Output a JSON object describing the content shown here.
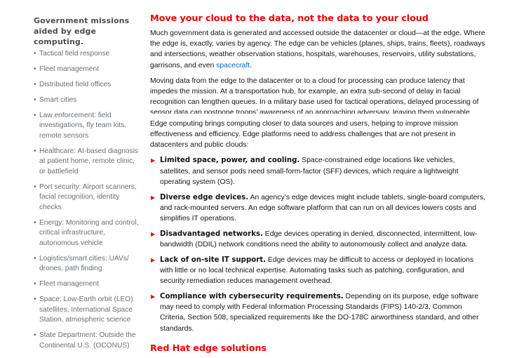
{
  "sidebar": {
    "title": "Government missions aided by edge computing.",
    "bullet": "•",
    "items": [
      {
        "label": "Tactical field response"
      },
      {
        "label": "Fleet management"
      },
      {
        "label": "Distributed field offices"
      },
      {
        "label": "Smart cities"
      },
      {
        "label": "Law enforcement: field investigations, fly team kits, remote sensors"
      },
      {
        "label": "Healthcare: AI-based diagnosis at patient home, remote clinic, or battlefield"
      },
      {
        "label": "Port security: Airport scanners, facial recognition, identity checks"
      },
      {
        "label": "Energy: Monitoring and control, critical infrastructure, autonomous vehicle"
      },
      {
        "label": "Logistics/smart cities: UAVs/ drones, path finding"
      },
      {
        "label": "Fleet management"
      },
      {
        "label": "Space: Low-Earth orbit (LEO) satellites, International Space Station, atmospheric science"
      },
      {
        "label": "State Department: Outside the Continental U.S. (OCONUS)"
      }
    ]
  },
  "main": {
    "heading": "Move your cloud to the data, not the data to your cloud",
    "paragraph1_text": "Much government data is generated and accessed outside the datacenter or cloud—at the edge. Where the edge is, exactly, varies by agency. The edge can be vehicles (planes, ships, trains, fleets), roadways and intersections, weather observation stations, hospitals, warehouses, reservoirs, utility substations, garrisons, and even ",
    "paragraph1_link": "spacecraft",
    "paragraph1_end": ".",
    "paragraph2": "Moving data from the edge to the datacenter or to a cloud for processing can produce latency that impedes the mission. At a transportation hub, for example, an extra sub-second of delay in facial recognition can lengthen queues. In a military base used for tactical operations, delayed processing of sensor data can postpone troops’ awareness of an approaching adversary, leaving them vulnerable.",
    "paragraph3": "Edge computing brings computing closer to data sources and users, helping to improve mission effectiveness and efficiency. Edge platforms need to address challenges that are not present in datacenters and public clouds:",
    "arrow": "▶",
    "challenges": [
      {
        "title": "Limited space, power, and cooling.",
        "text": " Space-constrained edge locations like vehicles, satellites, and sensor pods need small-form-factor (SFF) devices, which require a lightweight operating system (OS)."
      },
      {
        "title": "Diverse edge devices.",
        "text": " An agency’s edge devices might include tablets, single-board computers, and rack-mounted servers. An edge software platform that can run on all devices lowers costs and simplifies IT operations."
      },
      {
        "title": "Disadvantaged networks.",
        "text": " Edge devices operating in denied, disconnected, intermittent, low-bandwidth (DDIL) network conditions need the ability to autonomously collect and analyze data."
      },
      {
        "title": "Lack of on-site IT support.",
        "text": " Edge devices may be difficult to access or deployed in locations with little or no local technical expertise. Automating tasks such as patching, configuration, and security remediation reduces management overhead."
      },
      {
        "title": "Compliance with cybersecurity requirements.",
        "text": " Depending on its purpose, edge software may need to comply with Federal Information Processing Standards (FIPS) 140-2/3, Common Criteria, Section 508, specialized requirements like the DO-178C airworthiness standard, and other standards."
      }
    ],
    "heading2": "Red Hat edge solutions"
  },
  "colors": {
    "accent_red": "#ee0000",
    "link_blue": "#0066cc",
    "sidebar_text": "#6a6e73"
  }
}
